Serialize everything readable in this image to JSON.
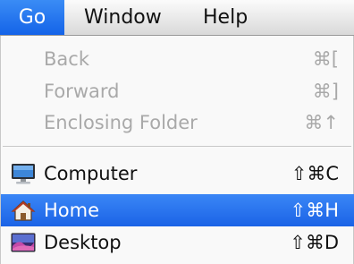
{
  "menubar": {
    "items": [
      {
        "label": "Go"
      },
      {
        "label": "Window"
      },
      {
        "label": "Help"
      }
    ]
  },
  "menu": {
    "items": [
      {
        "label": "Back",
        "shortcut": "⌘[",
        "enabled": false
      },
      {
        "label": "Forward",
        "shortcut": "⌘]",
        "enabled": false
      },
      {
        "label": "Enclosing Folder",
        "shortcut": "⌘↑",
        "enabled": false
      },
      {
        "label": "Computer",
        "shortcut": "⇧⌘C",
        "enabled": true,
        "icon": "computer-icon"
      },
      {
        "label": "Home",
        "shortcut": "⇧⌘H",
        "enabled": true,
        "selected": true,
        "icon": "home-icon"
      },
      {
        "label": "Desktop",
        "shortcut": "⇧⌘D",
        "enabled": true,
        "icon": "desktop-icon"
      }
    ]
  },
  "colors": {
    "selection": "#1b63e6",
    "disabled_text": "#a9a9a9"
  }
}
